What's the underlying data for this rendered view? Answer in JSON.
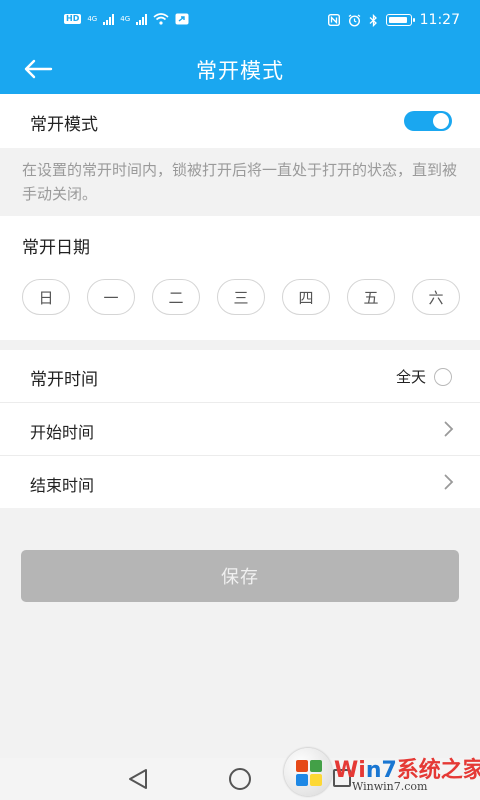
{
  "status_bar": {
    "time": "11:27",
    "left_badge": "HD",
    "network_a": "4G",
    "network_b": "4G"
  },
  "header": {
    "title": "常开模式"
  },
  "mode": {
    "label": "常开模式",
    "enabled": true
  },
  "description": "在设置的常开时间内，锁被打开后将一直处于打开的状态，直到被手动关闭。",
  "days_section": {
    "title": "常开日期",
    "days": [
      "日",
      "一",
      "二",
      "三",
      "四",
      "五",
      "六"
    ]
  },
  "time_section": {
    "title": "常开时间",
    "all_day_label": "全天",
    "start_label": "开始时间",
    "end_label": "结束时间"
  },
  "save_label": "保存",
  "watermark": {
    "brand_prefix": "Wi",
    "brand_num": "n7",
    "brand_cn": "系统之家",
    "url": "Winwin7.com"
  },
  "colors": {
    "accent": "#1aa7f0",
    "disabled_button": "#b5b5b5"
  }
}
